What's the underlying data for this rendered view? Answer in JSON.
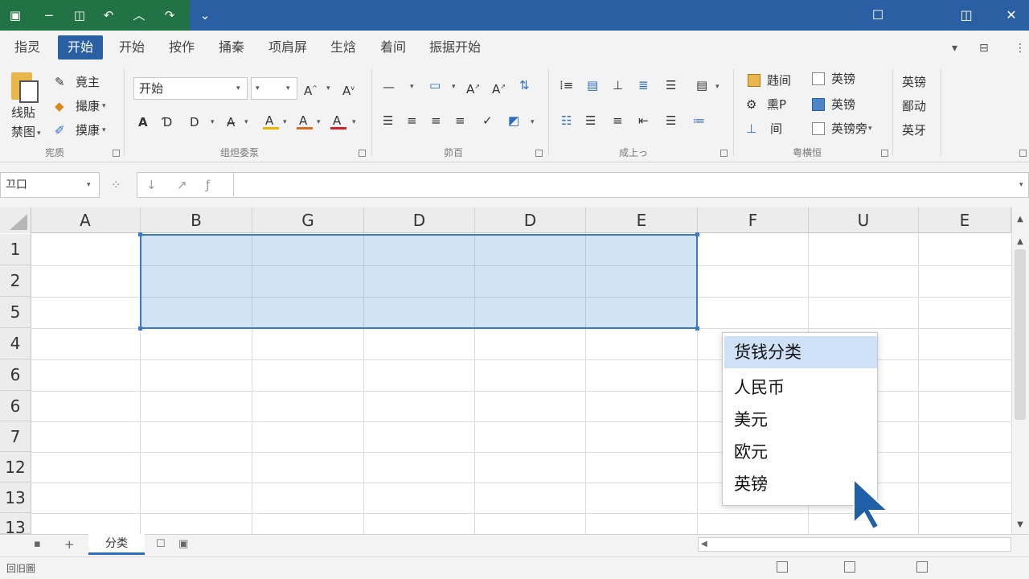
{
  "titlebar": {
    "colors": {
      "green": "#217346",
      "blue": "#2b5fa3"
    }
  },
  "menu": {
    "tabs": [
      "指灵",
      "开始",
      "开始",
      "按作",
      "捅秦",
      "项肩屏",
      "生焓",
      "着间",
      "振据开始"
    ],
    "active_index": 1
  },
  "ribbon": {
    "clipboard": {
      "paste_label_1": "线貼",
      "paste_label_2": "禁图",
      "item1": "竟主",
      "item2": "撮康",
      "item3": "摸康",
      "group": "宪质"
    },
    "font": {
      "font_name": "开始",
      "group": "组炟委泵"
    },
    "align_group": "茆百",
    "number_group": "成上っ",
    "styles": {
      "item1": "韪间",
      "item2": "熏P",
      "item3": "间",
      "item4": "英镑",
      "item5": "英镑",
      "item6": "英镑旁",
      "group": "粤横恒"
    },
    "cells": {
      "item1": "英镑",
      "item2": "鄙动",
      "item3": "英牙"
    }
  },
  "formula": {
    "namebox_value": "끄口",
    "formula_value": ""
  },
  "grid": {
    "columns": [
      "A",
      "B",
      "G",
      "D",
      "D",
      "E",
      "F",
      "U",
      "E"
    ],
    "rows": [
      "1",
      "2",
      "5",
      "4",
      "6",
      "6",
      "7",
      "12",
      "13",
      "13"
    ]
  },
  "dropdown": {
    "items": [
      "货钱分类",
      "人民币",
      "美元",
      "欧元",
      "英镑"
    ],
    "selected_index": 0
  },
  "sheets": {
    "add_label": "+",
    "active_sheet": "分类"
  },
  "status": {
    "text": "回旧圖"
  }
}
